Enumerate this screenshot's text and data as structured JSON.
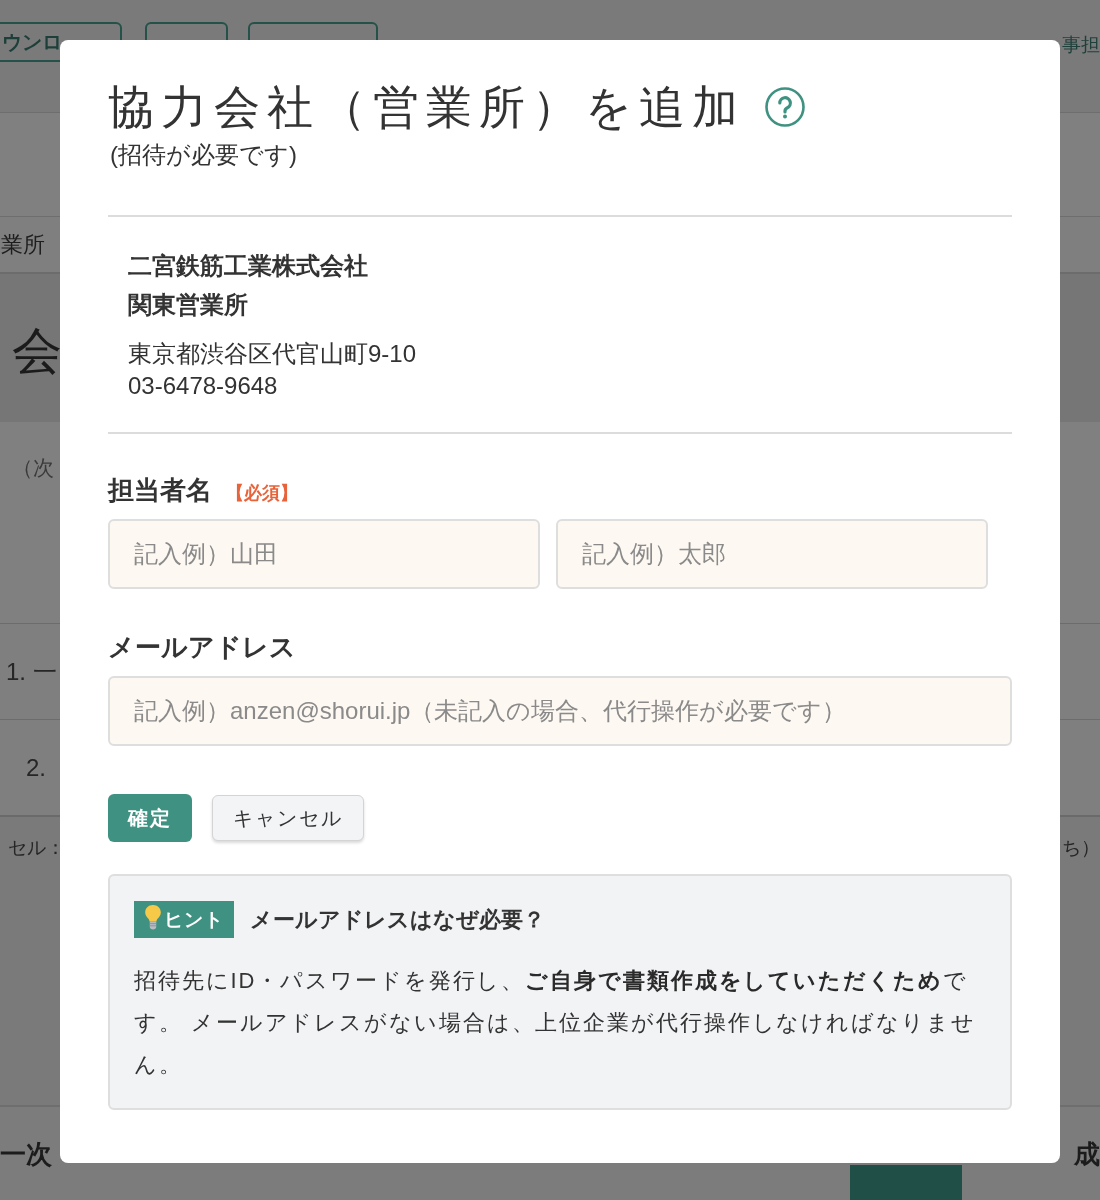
{
  "background_page": {
    "toolbar_button": "ウンロ",
    "breadcrumb": "事担",
    "tab_label": "業所",
    "heading": "会",
    "note": "（次",
    "list_items": [
      "1. 一",
      "2."
    ],
    "caption_left": "セル：",
    "caption_right": "ち）",
    "footer_left": "一次",
    "footer_right": "成"
  },
  "dialog": {
    "title": "協力会社（営業所）を追加",
    "subtitle": "(招待が必要です)",
    "company": {
      "name": "二宮鉄筋工業株式会社",
      "branch": "関東営業所",
      "address": "東京都渋谷区代官山町9-10",
      "phone": "03-6478-9648"
    },
    "fields": [
      {
        "label": "担当者名",
        "required_badge": "【必須】",
        "inputs": [
          {
            "placeholder": "記入例）山田"
          },
          {
            "placeholder": "記入例）太郎"
          }
        ]
      },
      {
        "label": "メールアドレス",
        "inputs": [
          {
            "placeholder": "記入例）anzen@shorui.jp（未記入の場合、代行操作が必要です）"
          }
        ]
      }
    ],
    "buttons": [
      {
        "label": "確定",
        "kind": "primary"
      },
      {
        "label": "キャンセル",
        "kind": "secondary"
      }
    ],
    "hint": {
      "badge": "ヒント",
      "title": "メールアドレスはなぜ必要？",
      "text": "招待先にID・パスワードを発行し、**ご自身で書類作成をしていただくため**です。 メールアドレスがない場合は、上位企業が代行操作しなければなりません。"
    }
  }
}
